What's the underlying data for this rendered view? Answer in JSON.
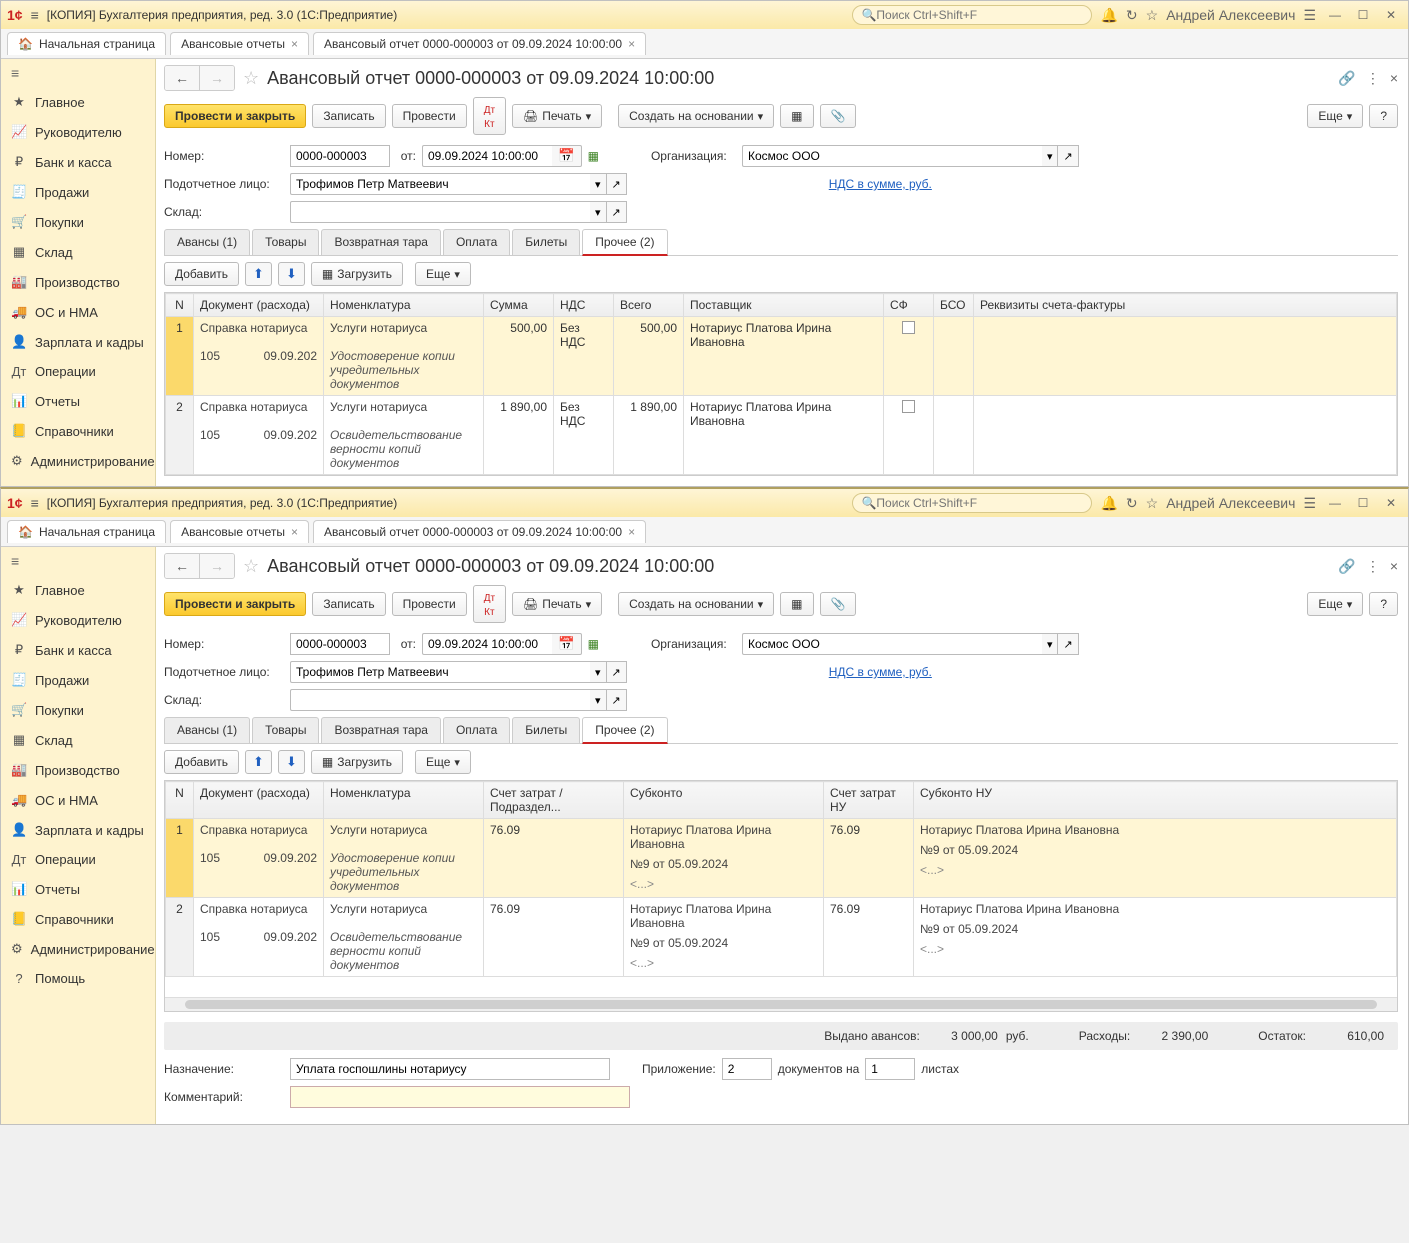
{
  "app": {
    "title": "[КОПИЯ] Бухгалтерия предприятия, ред. 3.0  (1С:Предприятие)",
    "search_placeholder": "Поиск Ctrl+Shift+F",
    "user": "Андрей Алексеевич"
  },
  "nav_tabs": {
    "home": "Начальная страница",
    "tab1": "Авансовые отчеты",
    "tab2": "Авансовый отчет 0000-000003 от 09.09.2024 10:00:00"
  },
  "sidebar": {
    "items": [
      {
        "icon": "≡",
        "label": ""
      },
      {
        "icon": "★",
        "label": "Главное"
      },
      {
        "icon": "📈",
        "label": "Руководителю"
      },
      {
        "icon": "₽",
        "label": "Банк и касса"
      },
      {
        "icon": "🧾",
        "label": "Продажи"
      },
      {
        "icon": "🛒",
        "label": "Покупки"
      },
      {
        "icon": "▦",
        "label": "Склад"
      },
      {
        "icon": "🏭",
        "label": "Производство"
      },
      {
        "icon": "🚚",
        "label": "ОС и НМА"
      },
      {
        "icon": "👤",
        "label": "Зарплата и кадры"
      },
      {
        "icon": "Дт",
        "label": "Операции"
      },
      {
        "icon": "📊",
        "label": "Отчеты"
      },
      {
        "icon": "📒",
        "label": "Справочники"
      },
      {
        "icon": "⚙",
        "label": "Администрирование"
      }
    ],
    "help": "Помощь"
  },
  "doc": {
    "title": "Авансовый отчет 0000-000003 от 09.09.2024 10:00:00",
    "btn_post_close": "Провести и закрыть",
    "btn_save": "Записать",
    "btn_post": "Провести",
    "btn_print": "Печать",
    "btn_create_based": "Создать на основании",
    "btn_more": "Еще",
    "lbl_number": "Номер:",
    "number": "0000-000003",
    "lbl_from": "от:",
    "date": "09.09.2024 10:00:00",
    "lbl_org": "Организация:",
    "org": "Космос ООО",
    "lbl_person": "Подотчетное лицо:",
    "person": "Трофимов Петр Матвеевич",
    "lbl_warehouse": "Склад:",
    "nds_link": "НДС в сумме, руб."
  },
  "inner_tabs": {
    "t1": "Авансы (1)",
    "t2": "Товары",
    "t3": "Возвратная тара",
    "t4": "Оплата",
    "t5": "Билеты",
    "t6": "Прочее (2)"
  },
  "subtoolbar": {
    "add": "Добавить",
    "load": "Загрузить",
    "more": "Еще"
  },
  "table1": {
    "headers": {
      "n": "N",
      "doc": "Документ (расхода)",
      "nomen": "Номенклатура",
      "sum": "Сумма",
      "nds": "НДС",
      "total": "Всего",
      "supplier": "Поставщик",
      "sf": "СФ",
      "bso": "БСО",
      "req": "Реквизиты счета-фактуры"
    },
    "rows": [
      {
        "n": "1",
        "doc1": "Справка нотариуса",
        "doc2a": "105",
        "doc2b": "09.09.202",
        "nomen1": "Услуги нотариуса",
        "nomen2": "Удостоверение копии учредительных документов",
        "sum": "500,00",
        "nds": "Без НДС",
        "total": "500,00",
        "supplier": "Нотариус Платова Ирина Ивановна"
      },
      {
        "n": "2",
        "doc1": "Справка нотариуса",
        "doc2a": "105",
        "doc2b": "09.09.202",
        "nomen1": "Услуги нотариуса",
        "nomen2": "Освидетельствование верности копий документов",
        "sum": "1 890,00",
        "nds": "Без НДС",
        "total": "1 890,00",
        "supplier": "Нотариус Платова Ирина Ивановна"
      }
    ]
  },
  "table2": {
    "headers": {
      "n": "N",
      "doc": "Документ (расхода)",
      "nomen": "Номенклатура",
      "acct": "Счет затрат / Подраздел...",
      "subk": "Субконто",
      "acctnu": "Счет затрат НУ",
      "subknu": "Субконто НУ"
    },
    "rows": [
      {
        "n": "1",
        "doc1": "Справка нотариуса",
        "doc2a": "105",
        "doc2b": "09.09.202",
        "nomen1": "Услуги нотариуса",
        "nomen2": "Удостоверение копии учредительных документов",
        "acct": "76.09",
        "subk1": "Нотариус Платова Ирина Ивановна",
        "subk2": "№9 от 05.09.2024",
        "subk3": "<...>",
        "acctnu": "76.09",
        "subknu1": "Нотариус Платова Ирина Ивановна",
        "subknu2": "№9 от 05.09.2024",
        "subknu3": "<...>"
      },
      {
        "n": "2",
        "doc1": "Справка нотариуса",
        "doc2a": "105",
        "doc2b": "09.09.202",
        "nomen1": "Услуги нотариуса",
        "nomen2": "Освидетельствование верности копий документов",
        "acct": "76.09",
        "subk1": "Нотариус Платова Ирина Ивановна",
        "subk2": "№9 от 05.09.2024",
        "subk3": "<...>",
        "acctnu": "76.09",
        "subknu1": "Нотариус Платова Ирина Ивановна",
        "subknu2": "№9 от 05.09.2024",
        "subknu3": "<...>"
      }
    ]
  },
  "summary": {
    "lbl_advance": "Выдано авансов:",
    "advance": "3 000,00",
    "cur": "руб.",
    "lbl_expense": "Расходы:",
    "expense": "2 390,00",
    "lbl_balance": "Остаток:",
    "balance": "610,00"
  },
  "bottom": {
    "lbl_purpose": "Назначение:",
    "purpose": "Уплата госпошлины нотариусу",
    "lbl_attach": "Приложение:",
    "attach_n": "2",
    "lbl_docs_on": "документов на",
    "sheets_n": "1",
    "lbl_sheets": "листах",
    "lbl_comment": "Комментарий:"
  }
}
